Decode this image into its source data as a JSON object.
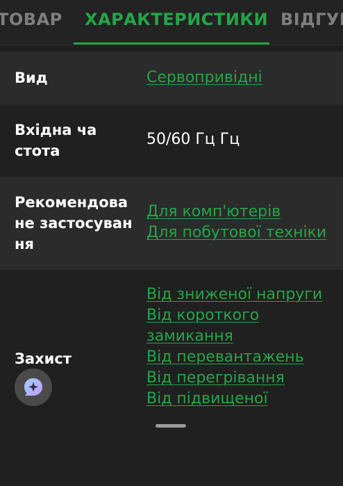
{
  "tabs": [
    {
      "label": "ТОВАР",
      "active": false
    },
    {
      "label": "ХАРАКТЕРИСТИКИ",
      "active": true
    },
    {
      "label": "ВІДГУК",
      "active": false
    }
  ],
  "colors": {
    "accent": "#23a649",
    "background": "#202020",
    "row_alt": "#2b2b2b",
    "text": "#ffffff",
    "tab_inactive": "#7f7f7f"
  },
  "specs": [
    {
      "label": "Вид",
      "links": [
        "Сервопривідні"
      ]
    },
    {
      "label": "Вхідна частота",
      "value": "50/60 Гц Гц"
    },
    {
      "label": "Рекомендоване застосування",
      "links": [
        "Для комп'ютерів",
        "Для побутової техніки"
      ]
    },
    {
      "label": "Захист",
      "links": [
        "Від зниженої напруги",
        "Від короткого замикання",
        "Від перевантажень",
        "Від перегрівання",
        "Від підвищеної"
      ]
    }
  ],
  "assistant": {
    "icon": "sparkle-chat-icon"
  }
}
